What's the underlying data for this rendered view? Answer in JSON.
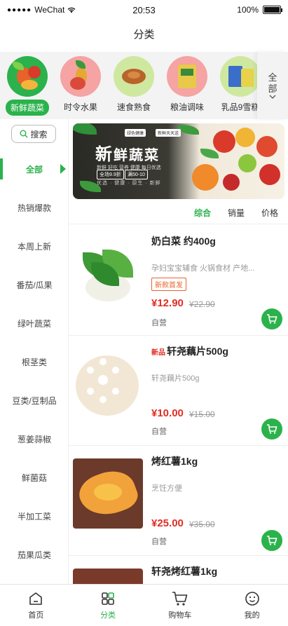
{
  "status_bar": {
    "carrier": "WeChat",
    "time": "20:53",
    "battery": "100%"
  },
  "page": {
    "title": "分类"
  },
  "categories": [
    {
      "label": "新鲜蔬菜",
      "active": true
    },
    {
      "label": "时令水果",
      "active": false
    },
    {
      "label": "速食熟食",
      "active": false
    },
    {
      "label": "粮油调味",
      "active": false
    },
    {
      "label": "乳品9雪糕",
      "active": false
    }
  ],
  "more": {
    "line1": "全",
    "line2": "部"
  },
  "sidebar": {
    "search_label": "搜索",
    "items": [
      {
        "label": "全部",
        "active": true
      },
      {
        "label": "热销爆款"
      },
      {
        "label": "本周上新"
      },
      {
        "label": "番茄/瓜果"
      },
      {
        "label": "绿叶蔬菜"
      },
      {
        "label": "根茎类"
      },
      {
        "label": "豆类/豆制品"
      },
      {
        "label": "葱姜蒜椒"
      },
      {
        "label": "鲜菌菇"
      },
      {
        "label": "半加工菜"
      },
      {
        "label": "茄果瓜类"
      }
    ]
  },
  "banner": {
    "title_a": "新",
    "title_b": "鲜蔬菜",
    "badge1": "绿色健康",
    "badge2": "新鲜天天送",
    "sub": "新鲜 好吃 营养 健康 每日优选",
    "tag1": "全场9.9折",
    "tag2": "满50-10",
    "slogan": "优选 · 健康 · 原生 · 新鲜"
  },
  "sort": {
    "comprehensive": "综合",
    "sales": "销量",
    "price": "价格"
  },
  "products": [
    {
      "name": "奶白菜 约400g",
      "desc": "孕妇宝宝辅食 火锅食材 产地...",
      "badge": "新款首发",
      "price": "¥12.90",
      "old_price": "¥22.90",
      "store": "自营"
    },
    {
      "new_tag": "新品",
      "name": "轩尧藕片500g",
      "desc": "轩尧藕片500g",
      "price": "¥10.00",
      "old_price": "¥15.00",
      "store": "自营"
    },
    {
      "name": "烤红薯1kg",
      "desc": "烹饪方便",
      "price": "¥25.00",
      "old_price": "¥35.00",
      "store": "自营"
    },
    {
      "name": "轩尧烤红薯1kg"
    }
  ],
  "tabbar": [
    {
      "label": "首页",
      "icon": "home-icon"
    },
    {
      "label": "分类",
      "icon": "category-icon",
      "active": true
    },
    {
      "label": "购物车",
      "icon": "cart-icon"
    },
    {
      "label": "我的",
      "icon": "profile-icon"
    }
  ],
  "colors": {
    "accent": "#2bb24c",
    "price": "#e02e24",
    "badge": "#e8632b"
  }
}
